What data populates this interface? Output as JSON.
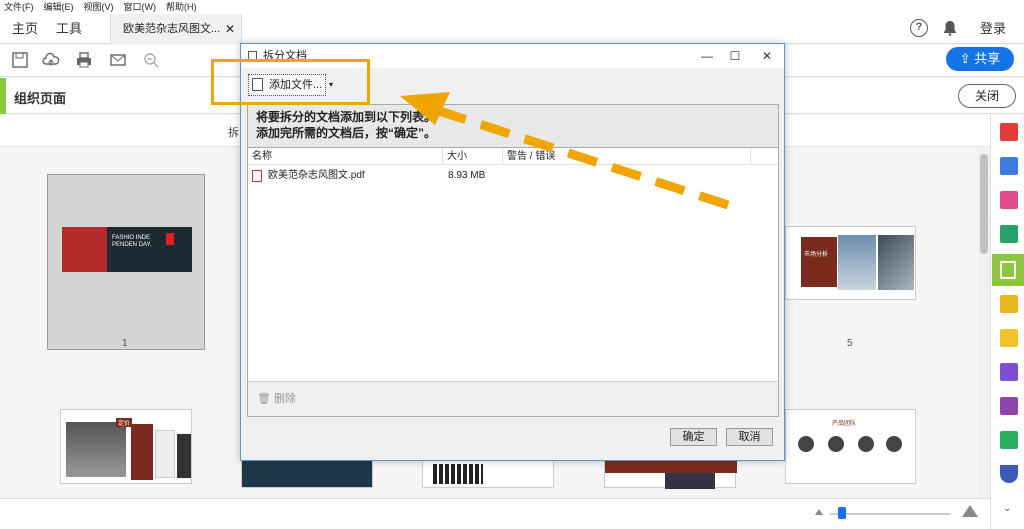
{
  "menu": [
    "文件(F)",
    "编辑(E)",
    "视图(V)",
    "窗口(W)",
    "帮助(H)"
  ],
  "tabs": {
    "home": "主页",
    "tools": "工具",
    "doc": "欧美范杂志风图文..."
  },
  "header": {
    "login": "登录",
    "share": "共享"
  },
  "organize": {
    "title": "组织页面",
    "close": "关闭",
    "subtext": "拆"
  },
  "pages": {
    "p1": "1",
    "p5": "5"
  },
  "dialog": {
    "title": "拆分文档",
    "add_file": "添加文件...",
    "instruction_line1": "将要拆分的文档添加到以下列表。",
    "instruction_line2": "添加完所需的文档后，按“确定”。",
    "columns": {
      "name": "名称",
      "size": "大小",
      "warn": "警告 / 错误"
    },
    "file": {
      "name": "欧美范杂志风图文.pdf",
      "size": "8.93 MB"
    },
    "delete": "删除",
    "ok": "确定",
    "cancel": "取消"
  },
  "thumb_text": {
    "fashion": "FASHIO INDE PENDEN DAY.",
    "market": "市场分析",
    "product": "产品团队",
    "price": "定价"
  },
  "colors": {
    "accent": "#1473e6",
    "highlight": "#f0a500",
    "organize_green": "#8dc63f"
  }
}
